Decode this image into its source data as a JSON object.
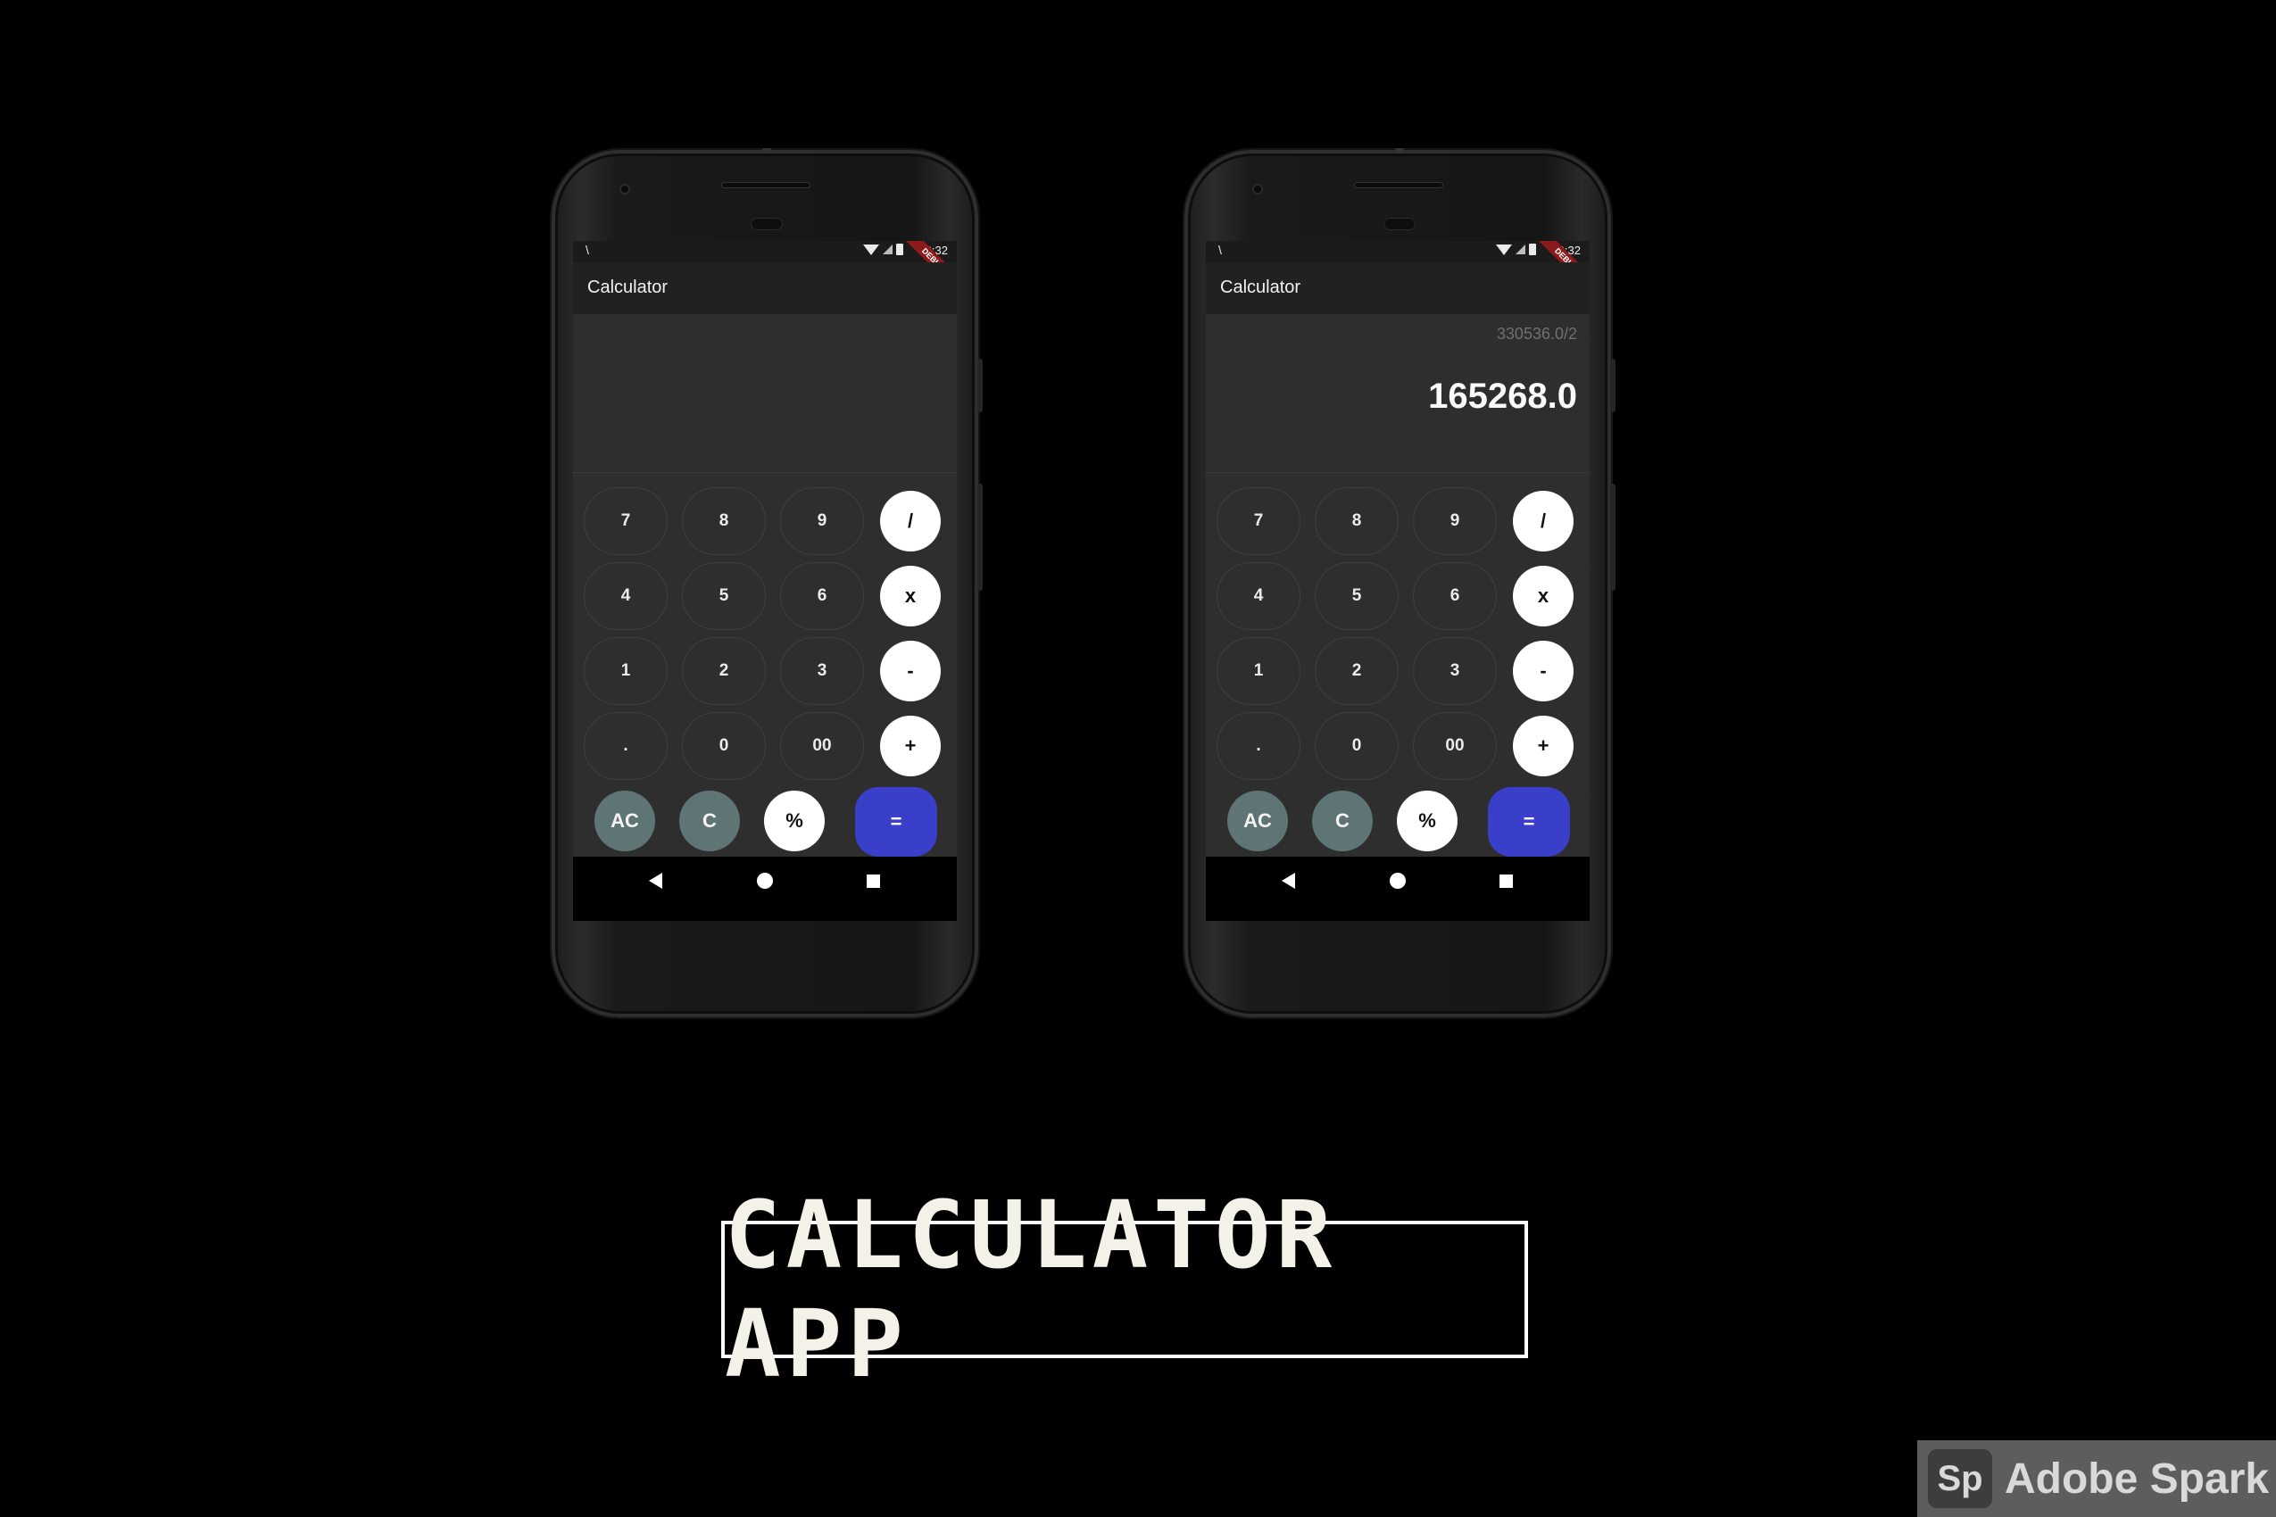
{
  "banner": {
    "title": "CALCULATOR APP"
  },
  "watermark": {
    "logo": "Sp",
    "brand": "Adobe Spark"
  },
  "phones": [
    {
      "status": {
        "notif": "\\",
        "time": "10:32",
        "ribbon": "DEBUG"
      },
      "app_title": "Calculator",
      "display": {
        "expression": "",
        "result": ""
      }
    },
    {
      "status": {
        "notif": "\\",
        "time": "10:32",
        "ribbon": "DEBUG"
      },
      "app_title": "Calculator",
      "display": {
        "expression": "330536.0/2",
        "result": "165268.0"
      }
    }
  ],
  "keys": {
    "row1": [
      "7",
      "8",
      "9",
      "/"
    ],
    "row2": [
      "4",
      "5",
      "6",
      "x"
    ],
    "row3": [
      "1",
      "2",
      "3",
      "-"
    ],
    "row4": [
      ".",
      "0",
      "00",
      "+"
    ],
    "row5": [
      "AC",
      "C",
      "%",
      "="
    ]
  },
  "colors": {
    "equals_button": "#3a3fca",
    "clear_buttons": "#5f7475",
    "operator_buttons": "#ffffff",
    "display_bg": "#2e2e2e",
    "appbar_bg": "#212121"
  }
}
